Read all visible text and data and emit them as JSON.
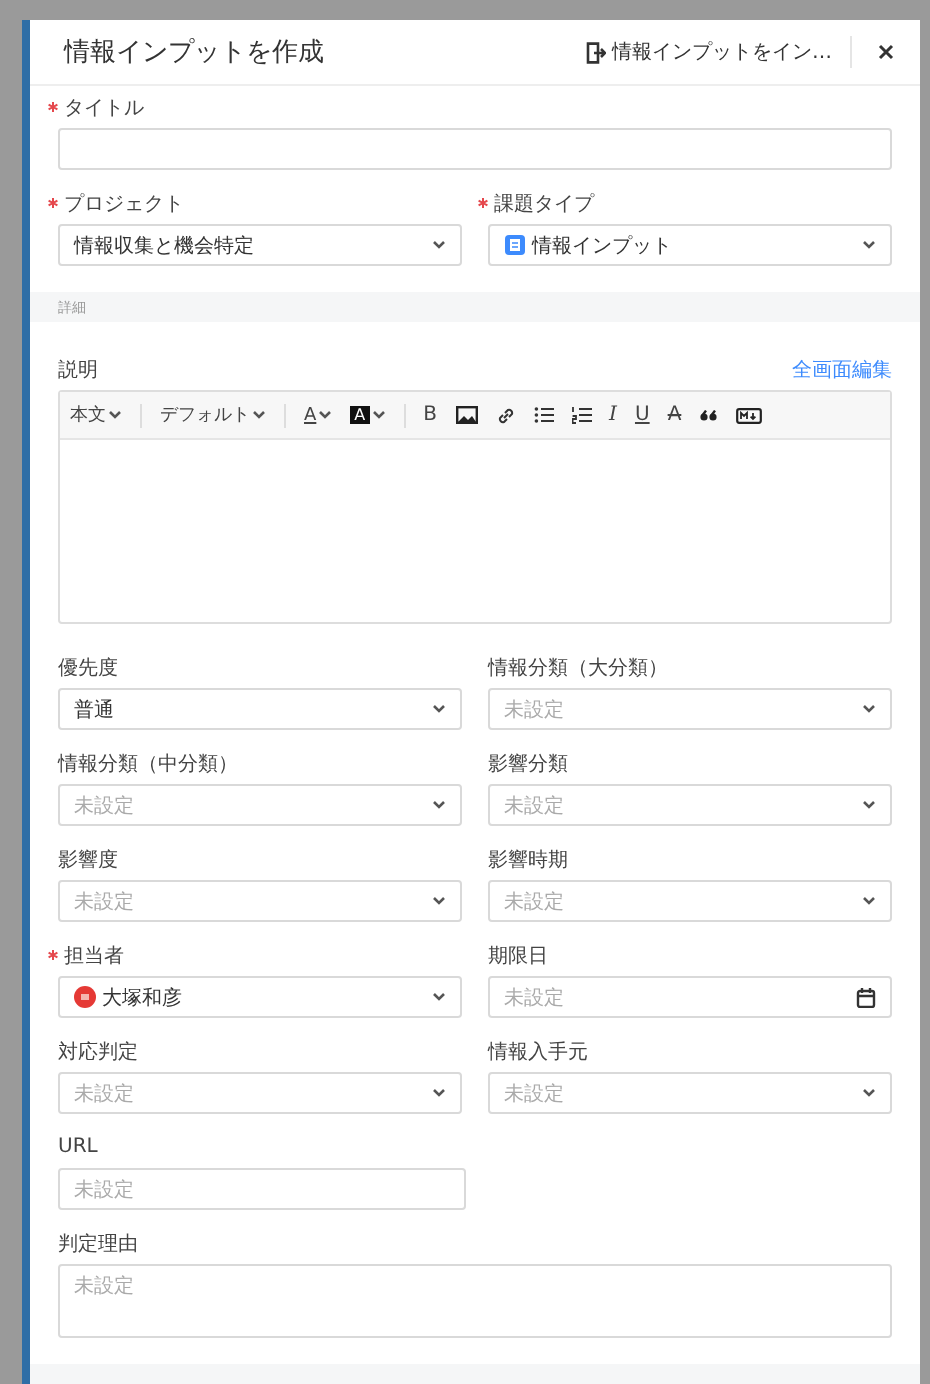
{
  "dialog": {
    "title": "情報インプットを作成",
    "import_button": "情報インプットをイン…"
  },
  "rows": [
    {
      "kind": "fields",
      "fields": [
        {
          "kind": "textline",
          "label": "タイトル",
          "required": true
        }
      ]
    },
    {
      "kind": "fields",
      "fields": [
        {
          "kind": "select",
          "label": "プロジェクト",
          "required": true,
          "value": "情報収集と機会特定"
        },
        {
          "kind": "type_select",
          "label": "課題タイプ",
          "required": true,
          "value": "情報インプット"
        }
      ]
    },
    {
      "kind": "section",
      "label": "詳細"
    },
    {
      "kind": "editor",
      "label": "説明",
      "link": "全画面編集",
      "toolbar": [
        {
          "kind": "dropdown",
          "label": "本文"
        },
        {
          "kind": "separator"
        },
        {
          "kind": "dropdown",
          "label": "デフォルト"
        },
        {
          "kind": "separator"
        },
        {
          "kind": "color",
          "label": "A"
        },
        {
          "kind": "highlight",
          "label": "A"
        },
        {
          "kind": "separator"
        },
        {
          "kind": "bold",
          "label": "B"
        },
        {
          "kind": "image"
        },
        {
          "kind": "link"
        },
        {
          "kind": "bullets"
        },
        {
          "kind": "numbers"
        },
        {
          "kind": "italic",
          "label": "I"
        },
        {
          "kind": "underline",
          "label": "U"
        },
        {
          "kind": "strike",
          "label": "A"
        },
        {
          "kind": "quote"
        },
        {
          "kind": "markdown"
        }
      ]
    },
    {
      "kind": "fields",
      "fields": [
        {
          "kind": "select",
          "label": "優先度",
          "required": false,
          "value": "普通"
        },
        {
          "kind": "select",
          "label": "情報分類（大分類）",
          "required": false,
          "placeholder": "未設定"
        }
      ]
    },
    {
      "kind": "fields",
      "fields": [
        {
          "kind": "select",
          "label": "情報分類（中分類）",
          "required": false,
          "placeholder": "未設定"
        },
        {
          "kind": "select",
          "label": "影響分類",
          "required": false,
          "placeholder": "未設定"
        }
      ]
    },
    {
      "kind": "fields",
      "fields": [
        {
          "kind": "select",
          "label": "影響度",
          "required": false,
          "placeholder": "未設定"
        },
        {
          "kind": "select",
          "label": "影響時期",
          "required": false,
          "placeholder": "未設定"
        }
      ]
    },
    {
      "kind": "fields",
      "fields": [
        {
          "kind": "user_select",
          "label": "担当者",
          "required": true,
          "value": "大塚和彦"
        },
        {
          "kind": "date",
          "label": "期限日",
          "required": false,
          "placeholder": "未設定"
        }
      ]
    },
    {
      "kind": "fields",
      "fields": [
        {
          "kind": "select",
          "label": "対応判定",
          "required": false,
          "placeholder": "未設定"
        },
        {
          "kind": "select",
          "label": "情報入手元",
          "required": false,
          "placeholder": "未設定"
        }
      ]
    },
    {
      "kind": "fields",
      "fields": [
        {
          "kind": "text",
          "label": "URL",
          "required": false,
          "placeholder": "未設定"
        }
      ]
    },
    {
      "kind": "fields",
      "fields": [
        {
          "kind": "textarea",
          "label": "判定理由",
          "required": false,
          "placeholder": "未設定"
        }
      ]
    },
    {
      "kind": "section"
    }
  ]
}
